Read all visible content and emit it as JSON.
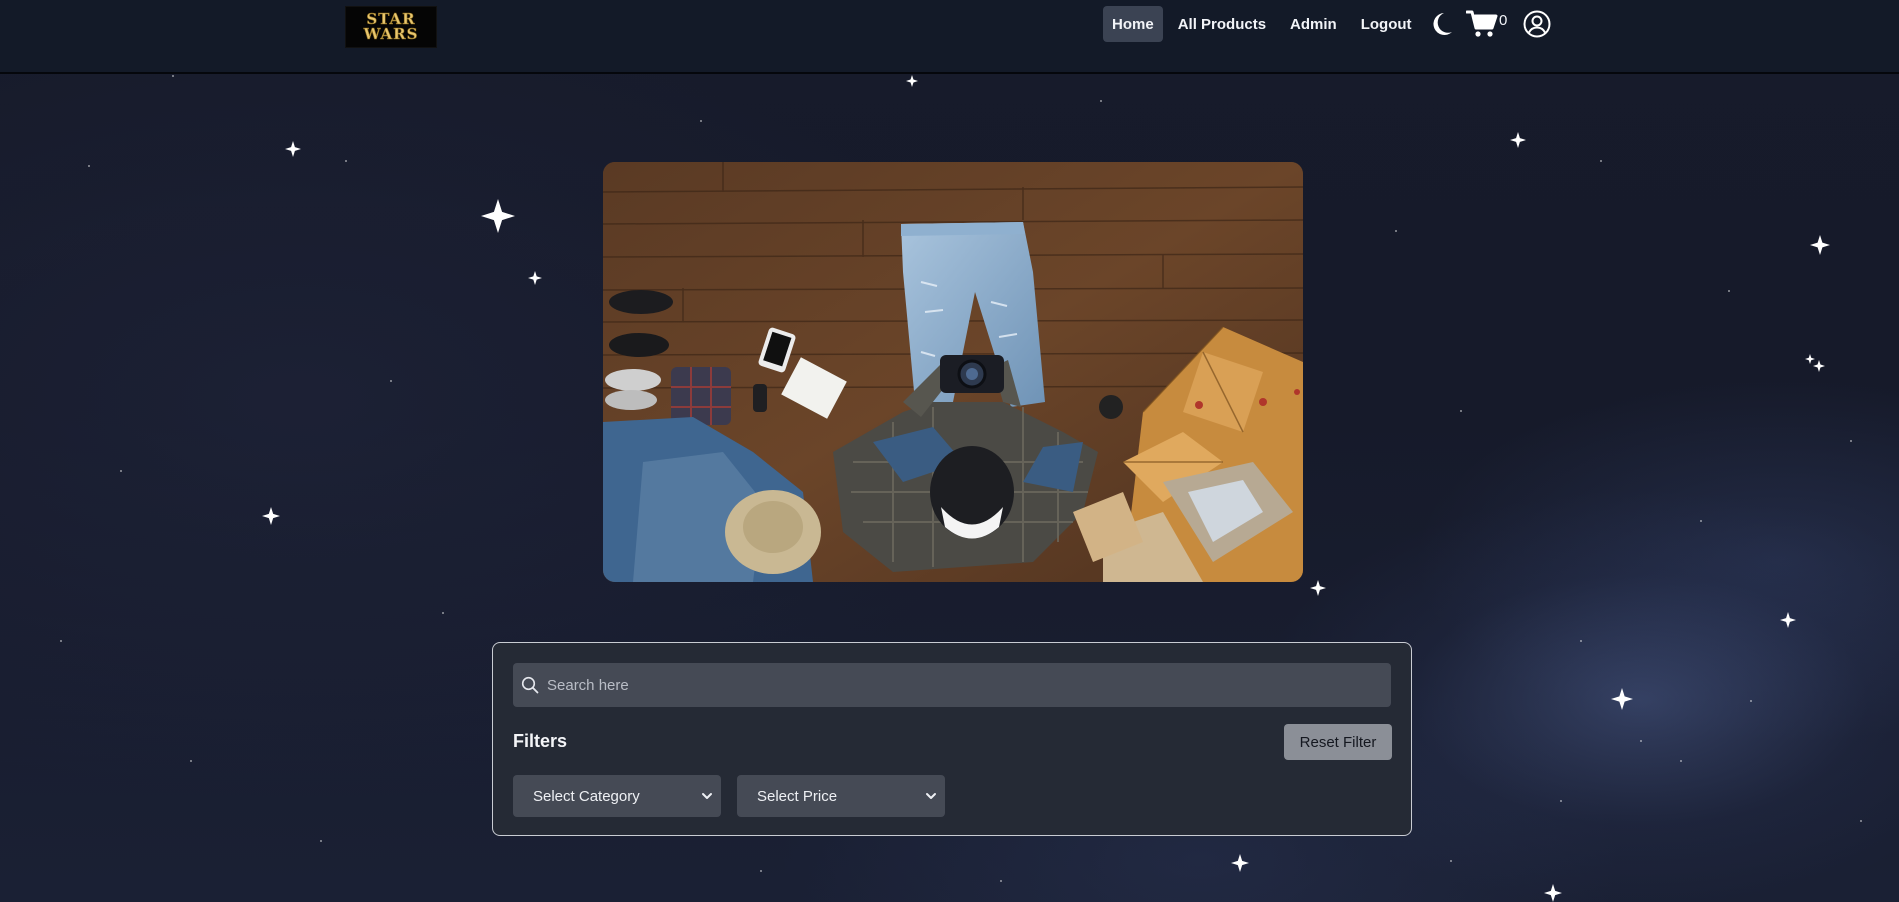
{
  "header": {
    "logo_line1": "STAR",
    "logo_line2": "WARS",
    "nav": [
      {
        "label": "Home",
        "active": true
      },
      {
        "label": "All Products",
        "active": false
      },
      {
        "label": "Admin",
        "active": false
      },
      {
        "label": "Logout",
        "active": false
      }
    ],
    "icons": {
      "theme_toggle": "moon-icon",
      "cart": "cart-icon",
      "profile": "user-circle-icon"
    },
    "cart_count": "0"
  },
  "hero": {
    "image": "photo-of-person-photographing-clothes-on-wooden-floor"
  },
  "filters": {
    "search_placeholder": "Search here",
    "search_value": "",
    "title": "Filters",
    "reset_label": "Reset Filter",
    "category_select": "Select Category",
    "price_select": "Select Price"
  },
  "colors": {
    "page_bg": "#171b2b",
    "navbar_bg": "#131a28",
    "active_nav_bg": "#3b4353",
    "panel_bg": "#252a35",
    "input_bg": "#454a55",
    "reset_bg": "#8b8f97"
  }
}
